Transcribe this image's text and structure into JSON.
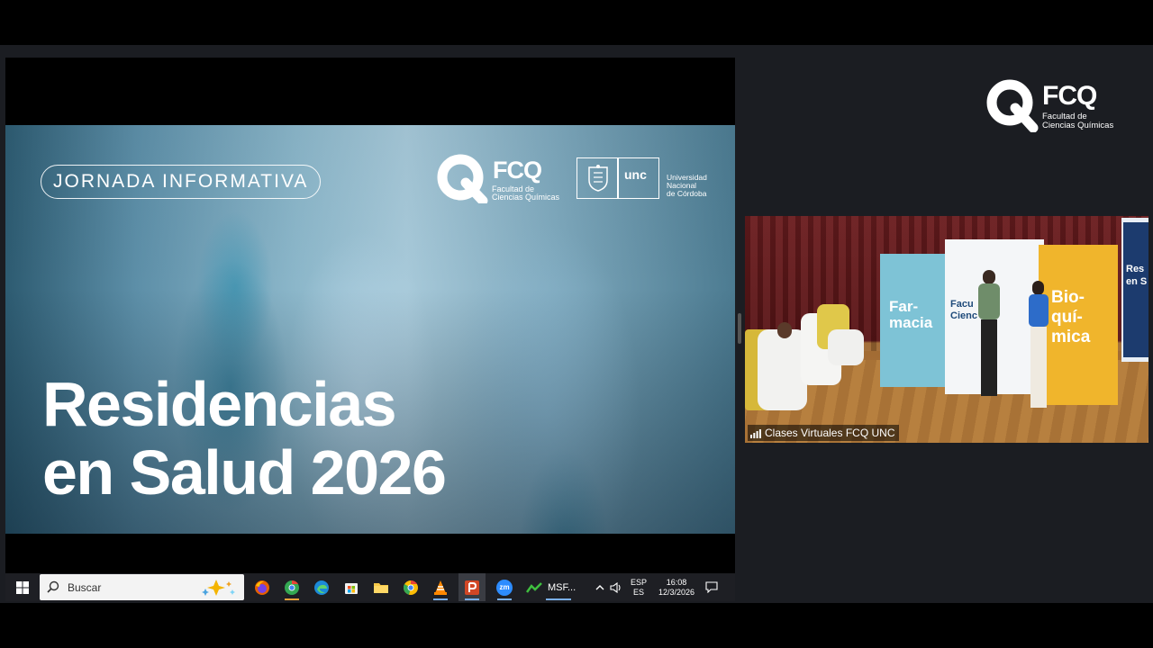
{
  "slide": {
    "tag": "JORNADA INFORMATIVA",
    "title_line1": "Residencias",
    "title_line2": "en Salud 2026",
    "logo_fcq": {
      "name": "FCQ",
      "line1": "Facultad de",
      "line2": "Ciencias Químicas"
    },
    "logo_unc": {
      "mark": "unc",
      "line1": "Universidad",
      "line2": "Nacional",
      "line3": "de Córdoba"
    }
  },
  "taskbar": {
    "search_placeholder": "Buscar",
    "apps": [
      "firefox-icon",
      "chrome-beta-icon",
      "edge-icon",
      "store-icon",
      "file-explorer-icon",
      "chrome-icon",
      "vlc-icon",
      "powerpoint-icon",
      "zoom-icon",
      "msf-icon"
    ],
    "zoom_label": "zm",
    "msf_label": "MSF...",
    "language_line1": "ESP",
    "language_line2": "ES",
    "time": "16:08",
    "date": "12/3/2026"
  },
  "brand": {
    "name": "FCQ",
    "line1": "Facultad de",
    "line2": "Ciencias Químicas"
  },
  "camera": {
    "label": "Clases Virtuales FCQ UNC",
    "banners": {
      "farmacia": "Far-\nmacia",
      "bioquimica": "Bio-\nquí-\nmica",
      "facultad": "Facu\nCienc",
      "screen_text": "Res\nen S"
    }
  },
  "colors": {
    "background": "#1b1d22",
    "taskbar": "#1e1f24",
    "banner_blue": "#7ec3d6",
    "banner_yellow": "#f0b52c"
  }
}
